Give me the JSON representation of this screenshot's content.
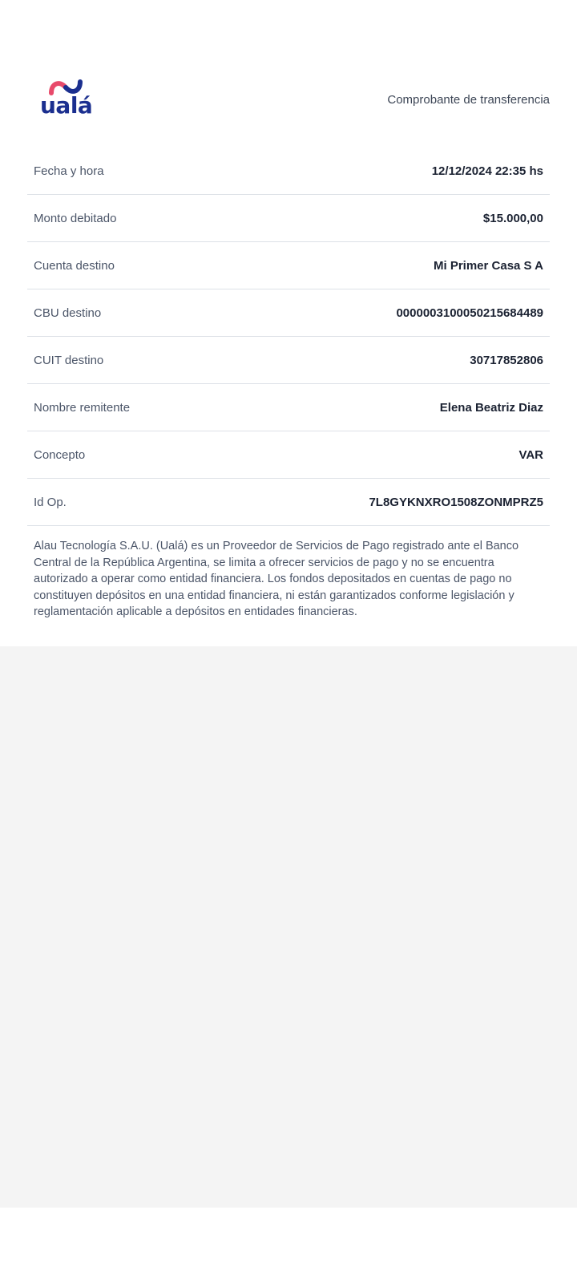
{
  "brand": {
    "logo_text": "ualá",
    "colors": {
      "wave_left": "#e84a6b",
      "wave_right": "#1b2f8f",
      "text": "#1b2f8f"
    }
  },
  "header": {
    "title": "Comprobante de transferencia"
  },
  "details": [
    {
      "label": "Fecha y hora",
      "value": "12/12/2024 22:35 hs"
    },
    {
      "label": "Monto debitado",
      "value": "$15.000,00"
    },
    {
      "label": "Cuenta destino",
      "value": "Mi Primer Casa S A"
    },
    {
      "label": "CBU destino",
      "value": "0000003100050215684489"
    },
    {
      "label": "CUIT destino",
      "value": "30717852806"
    },
    {
      "label": "Nombre remitente",
      "value": "Elena Beatriz Diaz"
    },
    {
      "label": "Concepto",
      "value": "VAR"
    },
    {
      "label": "Id Op.",
      "value": "7L8GYKNXRO1508ZONMPRZ5"
    }
  ],
  "disclaimer": "Alau Tecnología S.A.U. (Ualá) es un Proveedor de Servicios de Pago registrado ante el Banco Central de la República Argentina, se limita a ofrecer servicios de pago y no se encuentra autorizado a operar como entidad financiera. Los fondos depositados en cuentas de pago no constituyen depósitos en una entidad financiera, ni están garantizados conforme legislación y reglamentación aplicable a depósitos en entidades financieras."
}
